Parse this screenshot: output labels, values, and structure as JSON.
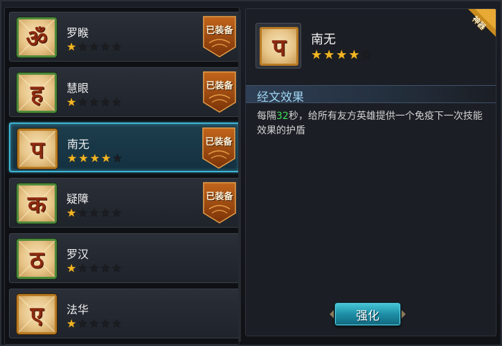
{
  "scripture_list": [
    {
      "name": "罗睺",
      "stars": 1,
      "max_stars": 5,
      "equipped": true,
      "glyph": "ॐ",
      "frame": "green"
    },
    {
      "name": "慧眼",
      "stars": 1,
      "max_stars": 5,
      "equipped": true,
      "glyph": "ह",
      "frame": "green"
    },
    {
      "name": "南无",
      "stars": 4,
      "max_stars": 5,
      "equipped": true,
      "glyph": "प",
      "frame": "orange",
      "selected": true
    },
    {
      "name": "疑障",
      "stars": 1,
      "max_stars": 5,
      "equipped": true,
      "glyph": "क",
      "frame": "green"
    },
    {
      "name": "罗汉",
      "stars": 1,
      "max_stars": 5,
      "equipped": false,
      "glyph": "ठ",
      "frame": "green"
    },
    {
      "name": "法华",
      "stars": 1,
      "max_stars": 5,
      "equipped": false,
      "glyph": "ए",
      "frame": "orange"
    }
  ],
  "equipped_label": "已装备",
  "detail": {
    "name": "南无",
    "stars": 4,
    "max_stars": 5,
    "glyph": "प",
    "corner_tag": "神器",
    "section_title": "经文效果",
    "desc_prefix": "每隔",
    "desc_number": "32",
    "desc_suffix": "秒，给所有友方英雄提供一个免疫下一次技能效果的护盾",
    "enhance_label": "强化"
  },
  "colors": {
    "star_on": "#f3b623",
    "star_off": "#1b1d21",
    "selected_border": "#3db5d4",
    "number_highlight": "#3ee05a",
    "section_title": "#9fd6f2"
  }
}
